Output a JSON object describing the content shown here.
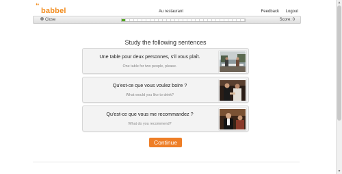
{
  "logo": {
    "text": "babbel",
    "mark": "“"
  },
  "header": {
    "lesson_title": "Au restaurant",
    "feedback": "Feedback",
    "logout": "Logout"
  },
  "toolbar": {
    "close_label": "Close",
    "score_label": "Score: 0",
    "progress": 0.03
  },
  "main": {
    "instructions": "Study the following sentences",
    "cards": [
      {
        "french": "Une table pour deux personnes, s'il vous plaît.",
        "english": "One table for two people, please.",
        "image": "restaurant-terrace-photo"
      },
      {
        "french": "Qu'est-ce que vous voulez boire ?",
        "english": "What would you like to drink?",
        "image": "waiter-serving-photo"
      },
      {
        "french": "Qu'est-ce que vous me recommandez ?",
        "english": "What do you recommend?",
        "image": "waiter-recommending-photo"
      }
    ],
    "continue_label": "Continue"
  },
  "colors": {
    "brand": "#f28c1e",
    "accent_button": "#ee7e27",
    "progress": "#52a51f"
  }
}
